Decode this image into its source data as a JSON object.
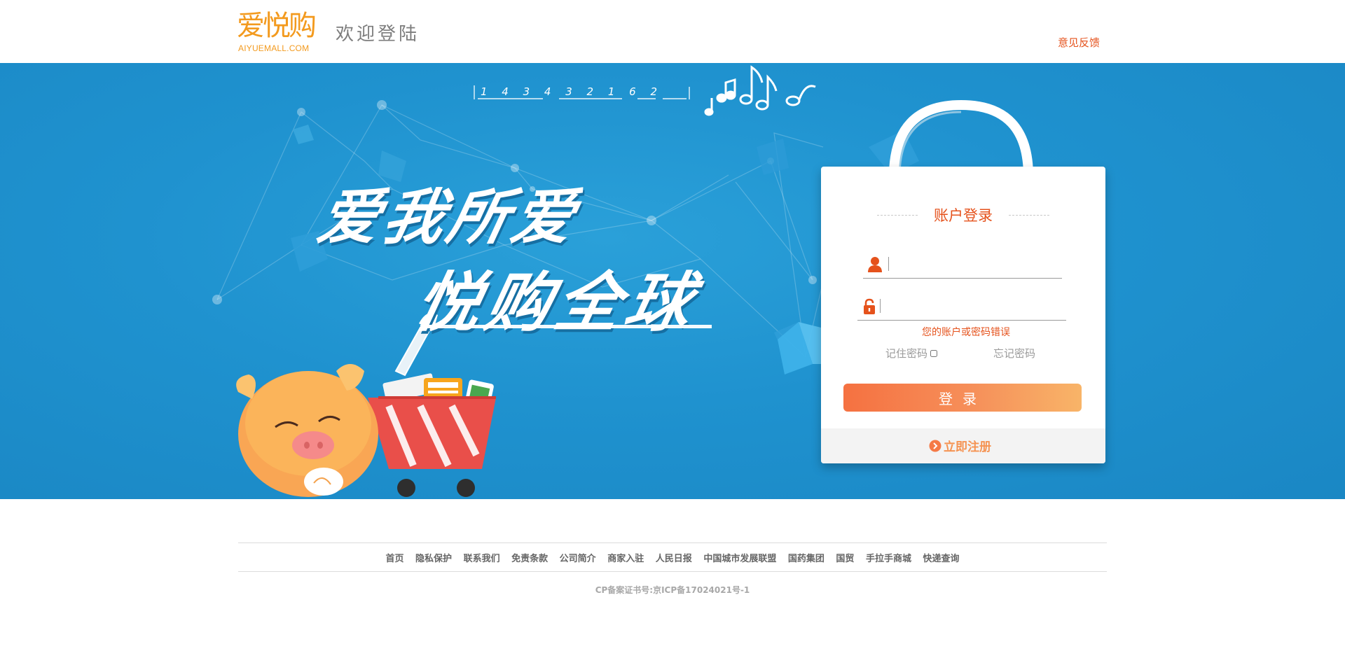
{
  "header": {
    "logo_mark": "爱悦购",
    "logo_domain": "AIYUEMALL.COM",
    "welcome": "欢迎登陆",
    "feedback": "意见反馈"
  },
  "banner": {
    "notation": "1  4  3   4  3  2 1 6 2",
    "slogan_line1": "爱我所爱",
    "slogan_line2": "悦购全球"
  },
  "login": {
    "title": "账户登录",
    "username_value": "",
    "password_value": "",
    "error": "您的账户或密码错误",
    "remember_label": "记住密码",
    "remember_checked": false,
    "forgot_label": "忘记密码",
    "submit_label": "登录",
    "register_label": "立即注册"
  },
  "footer": {
    "links": [
      "首页",
      "隐私保护",
      "联系我们",
      "免责条款",
      "公司简介",
      "商家入驻",
      "人民日报",
      "中国城市发展联盟",
      "国药集团",
      "国贸",
      "手拉手商城",
      "快递查询"
    ],
    "copyright": "CP备案证书号:京ICP备17024021号-1"
  },
  "colors": {
    "accent": "#e5521c",
    "brand_orange": "#f39a1e",
    "banner_blue": "#1f92cf",
    "button_start": "#f57141",
    "button_end": "#f8b468"
  },
  "icons": [
    "user-icon",
    "lock-icon",
    "register-arrow-icon",
    "music-notes-icon"
  ]
}
